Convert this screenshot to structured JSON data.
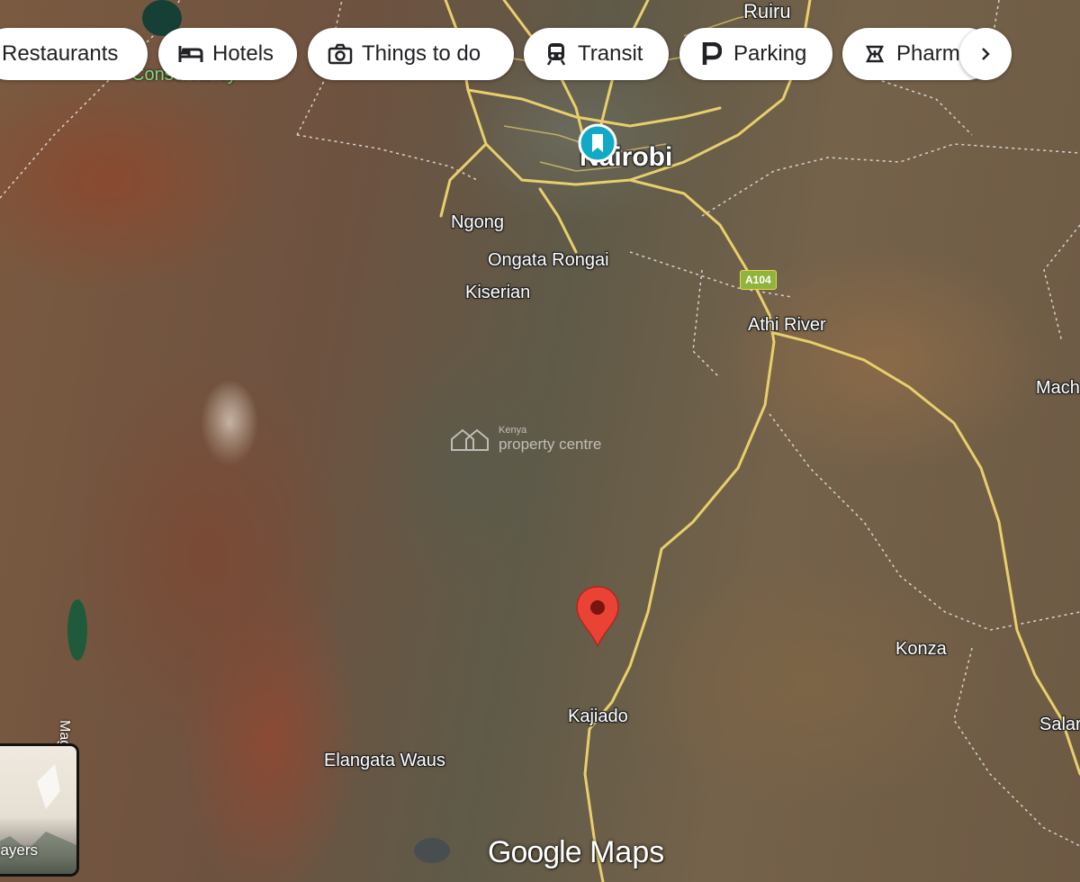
{
  "categories": [
    {
      "label": "Restaurants",
      "icon": "restaurant-icon"
    },
    {
      "label": "Hotels",
      "icon": "hotel-bed-icon"
    },
    {
      "label": "Things to do",
      "icon": "camera-icon"
    },
    {
      "label": "Transit",
      "icon": "train-icon"
    },
    {
      "label": "Parking",
      "icon": "parking-icon"
    },
    {
      "label": "Pharm",
      "icon": "pharmacy-icon"
    }
  ],
  "next_button_icon": "chevron-right-icon",
  "places": {
    "ruiru": "Ruiru",
    "nairobi": "Nairobi",
    "ngong": "Ngong",
    "ongata_rongai": "Ongata Rongai",
    "kiserian": "Kiserian",
    "athi_river": "Athi River",
    "mach": "Mach",
    "konza": "Konza",
    "kajiado": "Kajiado",
    "elangata_waus": "Elangata Waus",
    "salar": "Salar",
    "conservancy": "Conservancy"
  },
  "road_shield": "A104",
  "road_side_label": "Magadi",
  "watermark": {
    "small": "Kenya",
    "big": "property centre"
  },
  "layers_label": "Layers",
  "brand": {
    "google": "Google",
    "maps": "Maps"
  },
  "colors": {
    "road": "#e9cf6a",
    "marker_red": "#ea4335",
    "marker_blue": "#12a9c7",
    "shield": "#8fb43c"
  }
}
